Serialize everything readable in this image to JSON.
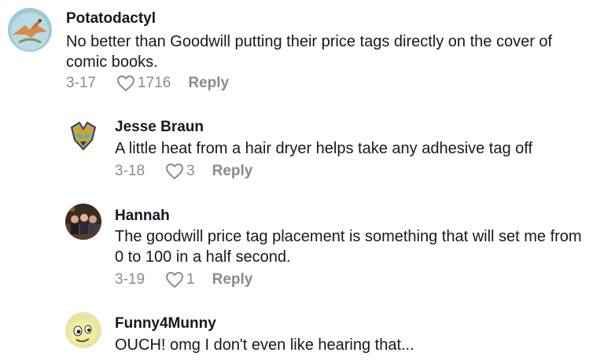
{
  "comments": [
    {
      "username": "Potatodactyl",
      "text": "No better than Goodwill putting their price tags directly on the cover of comic books.",
      "date": "3-17",
      "likes": "1716",
      "reply_label": "Reply",
      "avatar_icon": "pterodactyl-avatar"
    },
    {
      "username": "Jesse Braun",
      "text": "A little heat from a hair dryer helps take any adhesive tag off",
      "date": "3-18",
      "likes": "3",
      "reply_label": "Reply",
      "avatar_icon": "robot-helmet-avatar"
    },
    {
      "username": "Hannah",
      "text": "The goodwill price tag placement is something that will set me from 0 to 100 in a half second.",
      "date": "3-19",
      "likes": "1",
      "reply_label": "Reply",
      "avatar_icon": "group-photo-avatar"
    },
    {
      "username": "Funny4Munny",
      "text": "OUCH! omg I don't even like hearing that...",
      "avatar_icon": "cartoon-face-avatar"
    }
  ],
  "colors": {
    "text": "#161823",
    "muted": "#8a8b91"
  }
}
